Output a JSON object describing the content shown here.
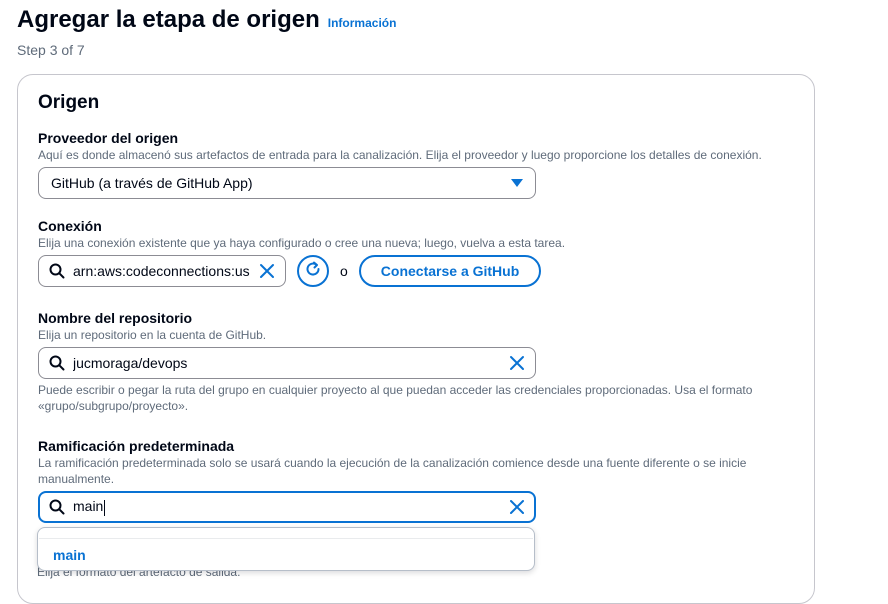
{
  "header": {
    "title": "Agregar la etapa de origen",
    "info_link": "Información",
    "step": "Step 3 of 7"
  },
  "card": {
    "title": "Origen"
  },
  "provider": {
    "label": "Proveedor del origen",
    "description": "Aquí es donde almacenó sus artefactos de entrada para la canalización. Elija el proveedor y luego proporcione los detalles de conexión.",
    "selected": "GitHub (a través de GitHub App)"
  },
  "connection": {
    "label": "Conexión",
    "description": "Elija una conexión existente que ya haya configurado o cree una nueva; luego, vuelva a esta tarea.",
    "value": "arn:aws:codeconnections:us",
    "or_text": "o",
    "connect_button": "Conectarse a GitHub"
  },
  "repository": {
    "label": "Nombre del repositorio",
    "description": "Elija un repositorio en la cuenta de GitHub.",
    "value": "jucmoraga/devops",
    "hint": "Puede escribir o pegar la ruta del grupo en cualquier proyecto al que puedan acceder las credenciales proporcionadas. Usa el formato «grupo/subgrupo/proyecto»."
  },
  "branch": {
    "label": "Ramificación predeterminada",
    "description": "La ramificación predeterminada solo se usará cuando la ejecución de la canalización comience desde una fuente diferente o se inicie manualmente.",
    "value": "main",
    "suggestion": "main"
  },
  "output": {
    "partial_description": "Elija el formato del artefacto de salida."
  },
  "colors": {
    "accent": "#0972d3",
    "text": "#000716",
    "muted": "#5f6b7a",
    "border": "#8c8c94"
  },
  "icons": [
    "search-icon",
    "clear-icon",
    "refresh-icon",
    "caret-down-icon"
  ]
}
